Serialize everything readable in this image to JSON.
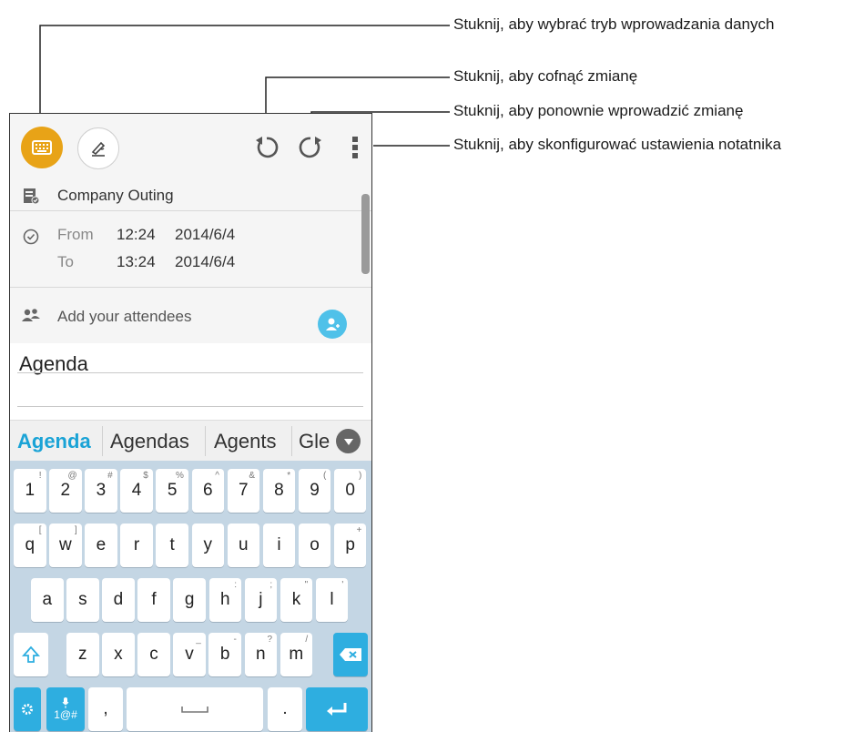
{
  "callouts": [
    {
      "id": "input-mode",
      "text": "Stuknij, aby wybrać tryb wprowadzania danych"
    },
    {
      "id": "undo",
      "text": "Stuknij, aby cofnąć zmianę"
    },
    {
      "id": "redo",
      "text": "Stuknij, aby ponownie wprowadzić zmianę"
    },
    {
      "id": "settings",
      "text": "Stuknij, aby skonfigurować ustawienia notatnika"
    }
  ],
  "colors": {
    "accent": "#e8a317",
    "kb_bg": "#c4d6e4",
    "blue": "#2eaee0",
    "add": "#4fc1e9"
  },
  "event": {
    "title": "Company Outing",
    "from_label": "From",
    "from_time": "12:24",
    "from_date": "2014/6/4",
    "to_label": "To",
    "to_time": "13:24",
    "to_date": "2014/6/4",
    "attendees_placeholder": "Add your attendees"
  },
  "notes": {
    "text": "Agenda"
  },
  "suggestions": [
    "Agenda",
    "Agendas",
    "Agents",
    "Gle"
  ],
  "keyboard": {
    "row1": [
      {
        "k": "1",
        "h": "!"
      },
      {
        "k": "2",
        "h": "@"
      },
      {
        "k": "3",
        "h": "#"
      },
      {
        "k": "4",
        "h": "$"
      },
      {
        "k": "5",
        "h": "%"
      },
      {
        "k": "6",
        "h": "^"
      },
      {
        "k": "7",
        "h": "&"
      },
      {
        "k": "8",
        "h": "*"
      },
      {
        "k": "9",
        "h": "("
      },
      {
        "k": "0",
        "h": ")"
      }
    ],
    "row2": [
      {
        "k": "q",
        "h": "["
      },
      {
        "k": "w",
        "h": "]"
      },
      {
        "k": "e",
        "h": ""
      },
      {
        "k": "r",
        "h": ""
      },
      {
        "k": "t",
        "h": ""
      },
      {
        "k": "y",
        "h": ""
      },
      {
        "k": "u",
        "h": ""
      },
      {
        "k": "i",
        "h": ""
      },
      {
        "k": "o",
        "h": ""
      },
      {
        "k": "p",
        "h": "+"
      }
    ],
    "row3": [
      {
        "k": "a",
        "h": ""
      },
      {
        "k": "s",
        "h": ""
      },
      {
        "k": "d",
        "h": ""
      },
      {
        "k": "f",
        "h": ""
      },
      {
        "k": "g",
        "h": ""
      },
      {
        "k": "h",
        "h": ":"
      },
      {
        "k": "j",
        "h": ";"
      },
      {
        "k": "k",
        "h": "\""
      },
      {
        "k": "l",
        "h": "'"
      }
    ],
    "row4": [
      {
        "k": "z",
        "h": ""
      },
      {
        "k": "x",
        "h": ""
      },
      {
        "k": "c",
        "h": ""
      },
      {
        "k": "v",
        "h": "_"
      },
      {
        "k": "b",
        "h": "-"
      },
      {
        "k": "n",
        "h": "?"
      },
      {
        "k": "m",
        "h": "/"
      }
    ],
    "sym_label": "1@#",
    "comma": ",",
    "period": "."
  }
}
